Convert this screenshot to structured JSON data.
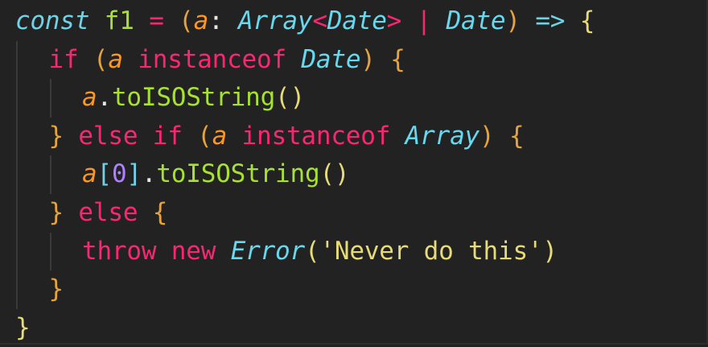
{
  "editor": {
    "lines": [
      {
        "indent": 0,
        "tokens": [
          {
            "t": "const",
            "c": "#6fd3e8",
            "i": true
          },
          {
            "t": " f1 ",
            "c": "#a6e22e"
          },
          {
            "t": "=",
            "c": "#f92672"
          },
          {
            "t": " ",
            "c": "#e8e8e0"
          },
          {
            "t": "(",
            "c": "#e6a23c"
          },
          {
            "t": "a",
            "c": "#fd971f",
            "i": true
          },
          {
            "t": ": ",
            "c": "#e8e8e0"
          },
          {
            "t": "Array",
            "c": "#66d9ef",
            "i": true
          },
          {
            "t": "<",
            "c": "#f92672"
          },
          {
            "t": "Date",
            "c": "#66d9ef",
            "i": true
          },
          {
            "t": ">",
            "c": "#f92672"
          },
          {
            "t": " | ",
            "c": "#f92672"
          },
          {
            "t": "Date",
            "c": "#66d9ef",
            "i": true
          },
          {
            "t": ")",
            "c": "#e6a23c"
          },
          {
            "t": " ",
            "c": "#e8e8e0"
          },
          {
            "t": "=>",
            "c": "#6fd3e8"
          },
          {
            "t": " ",
            "c": "#e8e8e0"
          },
          {
            "t": "{",
            "c": "#e6db74"
          }
        ]
      },
      {
        "indent": 1,
        "tokens": [
          {
            "t": "if",
            "c": "#f92672"
          },
          {
            "t": " ",
            "c": "#e8e8e0"
          },
          {
            "t": "(",
            "c": "#e6a23c"
          },
          {
            "t": "a",
            "c": "#fd971f",
            "i": true
          },
          {
            "t": " instanceof ",
            "c": "#f92672"
          },
          {
            "t": "Date",
            "c": "#66d9ef",
            "i": true
          },
          {
            "t": ")",
            "c": "#e6a23c"
          },
          {
            "t": " ",
            "c": "#e8e8e0"
          },
          {
            "t": "{",
            "c": "#e6a23c"
          }
        ]
      },
      {
        "indent": 2,
        "tokens": [
          {
            "t": "a",
            "c": "#fd971f",
            "i": true
          },
          {
            "t": ".",
            "c": "#e8e8e0"
          },
          {
            "t": "toISOString",
            "c": "#a6e22e"
          },
          {
            "t": "()",
            "c": "#e6db74"
          }
        ]
      },
      {
        "indent": 1,
        "tokens": [
          {
            "t": "}",
            "c": "#e6a23c"
          },
          {
            "t": " else if ",
            "c": "#f92672"
          },
          {
            "t": "(",
            "c": "#e6a23c"
          },
          {
            "t": "a",
            "c": "#fd971f",
            "i": true
          },
          {
            "t": " instanceof ",
            "c": "#f92672"
          },
          {
            "t": "Array",
            "c": "#66d9ef",
            "i": true
          },
          {
            "t": ")",
            "c": "#e6a23c"
          },
          {
            "t": " ",
            "c": "#e8e8e0"
          },
          {
            "t": "{",
            "c": "#e6a23c"
          }
        ]
      },
      {
        "indent": 2,
        "tokens": [
          {
            "t": "a",
            "c": "#fd971f",
            "i": true
          },
          {
            "t": "[",
            "c": "#6fd3e8"
          },
          {
            "t": "0",
            "c": "#ae81ff"
          },
          {
            "t": "]",
            "c": "#6fd3e8"
          },
          {
            "t": ".",
            "c": "#e8e8e0"
          },
          {
            "t": "toISOString",
            "c": "#a6e22e"
          },
          {
            "t": "()",
            "c": "#e6db74"
          }
        ]
      },
      {
        "indent": 1,
        "tokens": [
          {
            "t": "}",
            "c": "#e6a23c"
          },
          {
            "t": " else ",
            "c": "#f92672"
          },
          {
            "t": "{",
            "c": "#e6a23c"
          }
        ]
      },
      {
        "indent": 2,
        "tokens": [
          {
            "t": "throw new ",
            "c": "#f92672"
          },
          {
            "t": "Error",
            "c": "#66d9ef",
            "i": true
          },
          {
            "t": "(",
            "c": "#e6db74"
          },
          {
            "t": "'Never do this'",
            "c": "#e6db74"
          },
          {
            "t": ")",
            "c": "#e6db74"
          }
        ]
      },
      {
        "indent": 1,
        "tokens": [
          {
            "t": "}",
            "c": "#e6a23c"
          }
        ]
      },
      {
        "indent": 0,
        "tokens": [
          {
            "t": "}",
            "c": "#e6db74"
          }
        ]
      }
    ]
  }
}
